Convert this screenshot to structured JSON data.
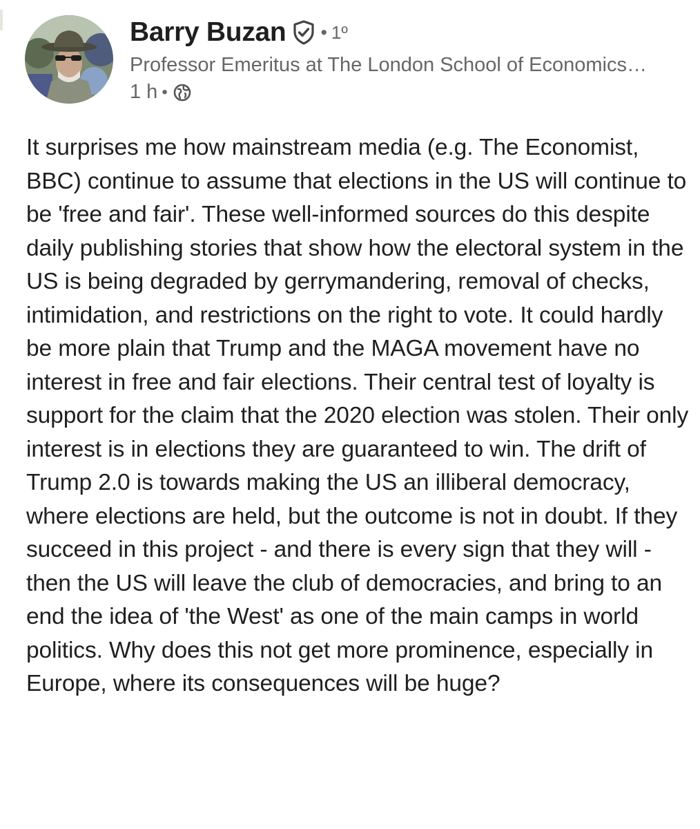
{
  "post": {
    "author": {
      "name": "Barry Buzan",
      "verified_icon": "verified-shield-icon",
      "degree_separator": "•",
      "connection_degree": "1º",
      "headline": "Professor Emeritus at The London School of Economics…",
      "avatar_icon": "profile-photo-avatar"
    },
    "meta": {
      "time": "1 h",
      "separator": "•",
      "visibility_icon": "globe-icon"
    },
    "body": "It surprises me how mainstream media (e.g. The Economist, BBC) continue to assume that elections in the US will continue to be 'free and fair'. These well-informed sources do this despite daily publishing stories that show how the electoral system in the US is being degraded by gerrymandering, removal of checks, intimidation, and restrictions on the right to vote. It could hardly be more plain that Trump and the MAGA movement have no interest in free and fair elections. Their central test of loyalty is support for the claim that the 2020 election was stolen. Their only interest is in elections they are guaranteed to win. The drift of Trump 2.0 is towards making the US an illiberal democracy, where elections are held, but the outcome is not in doubt. If they succeed in this project - and there is every sign that they will - then the US will leave the club of democracies, and bring to an end the idea of 'the West' as one of the main camps in world politics. Why does this not get more prominence, especially in Europe, where its consequences will be huge?"
  },
  "colors": {
    "text_primary": "#1f1f1f",
    "text_secondary": "#666666",
    "background": "#ffffff"
  }
}
